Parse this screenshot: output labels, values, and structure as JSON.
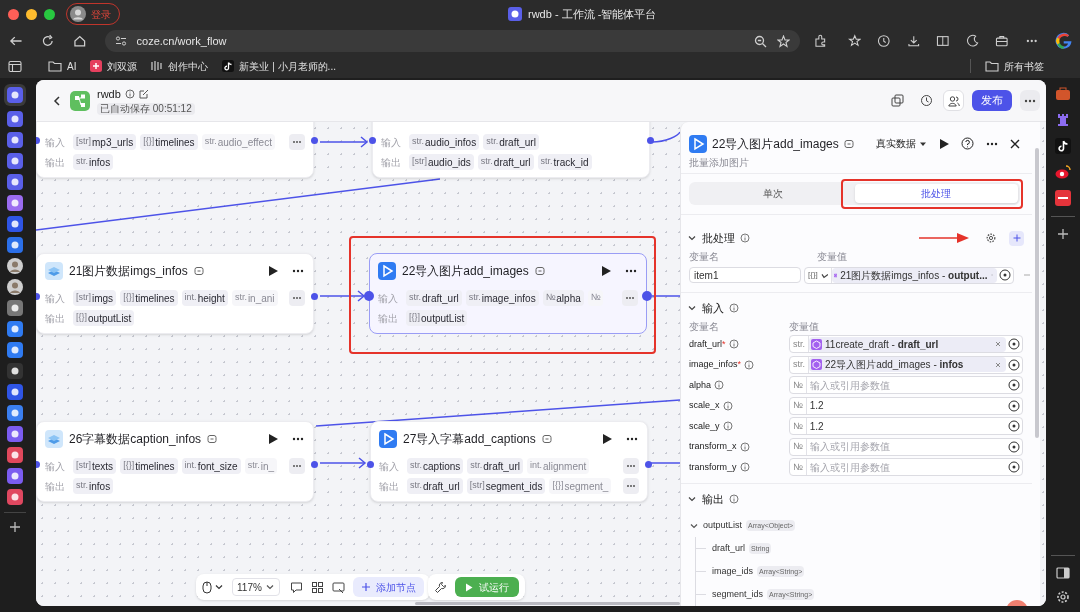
{
  "browser": {
    "login": "登录",
    "tab_title": "rwdb - 工作流 -智能体平台",
    "url": "coze.cn/work_flow",
    "bookmarks": [
      {
        "label": "AI",
        "kind": "folder"
      },
      {
        "label": "刘双源",
        "kind": "app"
      },
      {
        "label": "创作中心",
        "kind": "bars"
      },
      {
        "label": "新美业 | 小月老师的...",
        "kind": "note"
      }
    ],
    "all_bookmarks": "所有书签"
  },
  "header": {
    "title": "rwdb",
    "autosave": "已自动保存 00:51:12",
    "publish": "发布"
  },
  "nodes": [
    {
      "selected": false,
      "input_label": "输入",
      "output_label": "输出",
      "inputs": [
        {
          "type": "[str]",
          "name": "mp3_urls",
          "faded": false
        },
        {
          "type": "[{}]",
          "name": "timelines",
          "faded": false
        },
        {
          "type": "str.",
          "name": "audio_effect",
          "faded": true
        }
      ],
      "input_more": true,
      "outputs": [
        {
          "type": "str.",
          "name": "infos",
          "faded": false
        }
      ],
      "output_more": false
    },
    {
      "selected": false,
      "input_label": "输入",
      "output_label": "输出",
      "inputs": [
        {
          "type": "str.",
          "name": "audio_infos",
          "faded": false
        },
        {
          "type": "str.",
          "name": "draft_url",
          "faded": false
        }
      ],
      "input_more": false,
      "outputs": [
        {
          "type": "[str]",
          "name": "audio_ids",
          "faded": false
        },
        {
          "type": "str.",
          "name": "draft_url",
          "faded": false
        },
        {
          "type": "str.",
          "name": "track_id",
          "faded": false
        }
      ],
      "output_more": false
    },
    {
      "title": "21图片数据imgs_infos",
      "selected": false,
      "kind": "data",
      "input_label": "输入",
      "output_label": "输出",
      "inputs": [
        {
          "type": "[str]",
          "name": "imgs",
          "faded": false
        },
        {
          "type": "[{}]",
          "name": "timelines",
          "faded": false
        },
        {
          "type": "int.",
          "name": "height",
          "faded": false
        },
        {
          "type": "str.",
          "name": "in_ani",
          "faded": true
        }
      ],
      "input_more": true,
      "outputs": [
        {
          "type": "[{}]",
          "name": "outputList",
          "faded": false
        }
      ],
      "output_more": false
    },
    {
      "title": "22导入图片add_images",
      "selected": true,
      "kind": "plugin",
      "input_label": "输入",
      "output_label": "输出",
      "inputs": [
        {
          "type": "str.",
          "name": "draft_url",
          "faded": false
        },
        {
          "type": "str.",
          "name": "image_infos",
          "faded": false
        },
        {
          "type": "№",
          "name": "alpha",
          "faded": false
        },
        {
          "type": "№",
          "faded": true
        }
      ],
      "input_more": true,
      "outputs": [
        {
          "type": "[{}]",
          "name": "outputList",
          "faded": false
        }
      ],
      "output_more": false
    },
    {
      "title": "26字幕数据caption_infos",
      "selected": false,
      "kind": "data",
      "input_label": "输入",
      "output_label": "输出",
      "inputs": [
        {
          "type": "[str]",
          "name": "texts",
          "faded": false
        },
        {
          "type": "[{}]",
          "name": "timelines",
          "faded": false
        },
        {
          "type": "int.",
          "name": "font_size",
          "faded": false
        },
        {
          "type": "str.",
          "name": "in_",
          "faded": true
        }
      ],
      "input_more": true,
      "outputs": [
        {
          "type": "str.",
          "name": "infos",
          "faded": false
        }
      ],
      "output_more": false
    },
    {
      "title": "27导入字幕add_captions",
      "selected": false,
      "kind": "plugin",
      "input_label": "输入",
      "output_label": "输出",
      "inputs": [
        {
          "type": "str.",
          "name": "captions",
          "faded": false
        },
        {
          "type": "str.",
          "name": "draft_url",
          "faded": false
        },
        {
          "type": "int.",
          "name": "alignment",
          "faded": true
        }
      ],
      "input_more": true,
      "outputs": [
        {
          "type": "str.",
          "name": "draft_url",
          "faded": false
        },
        {
          "type": "[str]",
          "name": "segment_ids",
          "faded": false
        },
        {
          "type": "[{}]",
          "name": "segment_",
          "faded": true
        }
      ],
      "output_more": true
    }
  ],
  "panel": {
    "title": "22导入图片add_images",
    "data_mode": "真实数据",
    "description": "批量添加图片",
    "tabs": [
      {
        "label": "单次",
        "selected": false
      },
      {
        "label": "批处理",
        "selected": true
      }
    ],
    "batch": {
      "title": "批处理",
      "col_name": "变量名",
      "col_value": "变量值",
      "items": [
        {
          "name": "item1",
          "type": "[{}]",
          "ref": "21图片数据imgs_infos - **output...**"
        }
      ]
    },
    "inputs": {
      "title": "输入",
      "col_name": "变量名",
      "col_value": "变量值",
      "params": [
        {
          "name": "draft_url",
          "required_mark": "*",
          "type": "str.",
          "kind": "ref",
          "value": "11create_draft - **draft_url**"
        },
        {
          "name": "image_infos",
          "required_mark": "*",
          "type": "str.",
          "kind": "ref",
          "value": "22导入图片add_images - **infos**"
        },
        {
          "name": "alpha",
          "type": "№",
          "kind": "empty",
          "placeholder": "输入或引用参数值"
        },
        {
          "name": "scale_x",
          "type": "№",
          "kind": "literal",
          "value": "1.2"
        },
        {
          "name": "scale_y",
          "type": "№",
          "kind": "literal",
          "value": "1.2"
        },
        {
          "name": "transform_x",
          "type": "№",
          "kind": "empty",
          "placeholder": "输入或引用参数值"
        },
        {
          "name": "transform_y",
          "type": "№",
          "kind": "empty",
          "placeholder": "输入或引用参数值"
        }
      ]
    },
    "outputs": {
      "title": "输出",
      "tree": [
        {
          "name": "outputList",
          "type": "Array<Object>",
          "expanded": true,
          "children": [
            {
              "name": "draft_url",
              "type": "String"
            },
            {
              "name": "image_ids",
              "type": "Array<String>"
            },
            {
              "name": "segment_ids",
              "type": "Array<String>"
            }
          ]
        }
      ]
    }
  },
  "toolbar": {
    "zoom": "117%",
    "add_node": "添加节点",
    "test_run": "试运行"
  }
}
